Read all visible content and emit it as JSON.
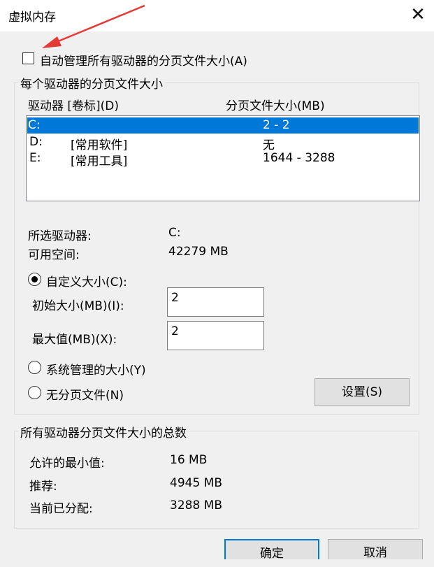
{
  "window": {
    "title": "虚拟内存",
    "close_glyph": "✕"
  },
  "auto_manage": {
    "label": "自动管理所有驱动器的分页文件大小(A)",
    "checked": false
  },
  "per_drive": {
    "group_title": "每个驱动器的分页文件大小",
    "columns": {
      "drive": "驱动器 [卷标](D)",
      "size": "分页文件大小(MB)"
    },
    "drives": [
      {
        "drive": "C:",
        "label": "",
        "size": "2 - 2",
        "selected": true
      },
      {
        "drive": "D:",
        "label": "[常用软件]",
        "size": "无",
        "selected": false
      },
      {
        "drive": "E:",
        "label": "[常用工具]",
        "size": "1644 - 3288",
        "selected": false
      }
    ],
    "selected_drive_label": "所选驱动器:",
    "selected_drive_value": "C:",
    "free_space_label": "可用空间:",
    "free_space_value": "42279 MB",
    "custom_size": {
      "label": "自定义大小(C):",
      "checked": true
    },
    "initial_size": {
      "label": "初始大小(MB)(I):",
      "value": "2"
    },
    "max_size": {
      "label": "最大值(MB)(X):",
      "value": "2"
    },
    "system_managed": {
      "label": "系统管理的大小(Y)",
      "checked": false
    },
    "no_paging": {
      "label": "无分页文件(N)",
      "checked": false
    },
    "set_button": "设置(S)"
  },
  "totals": {
    "group_title": "所有驱动器分页文件大小的总数",
    "min_label": "允许的最小值:",
    "min_value": "16 MB",
    "recommended_label": "推荐:",
    "recommended_value": "4945 MB",
    "allocated_label": "当前已分配:",
    "allocated_value": "3288 MB"
  },
  "buttons": {
    "ok": "确定",
    "cancel": "取消"
  },
  "colors": {
    "selection": "#0078d7",
    "annotation_arrow": "#e53935"
  }
}
